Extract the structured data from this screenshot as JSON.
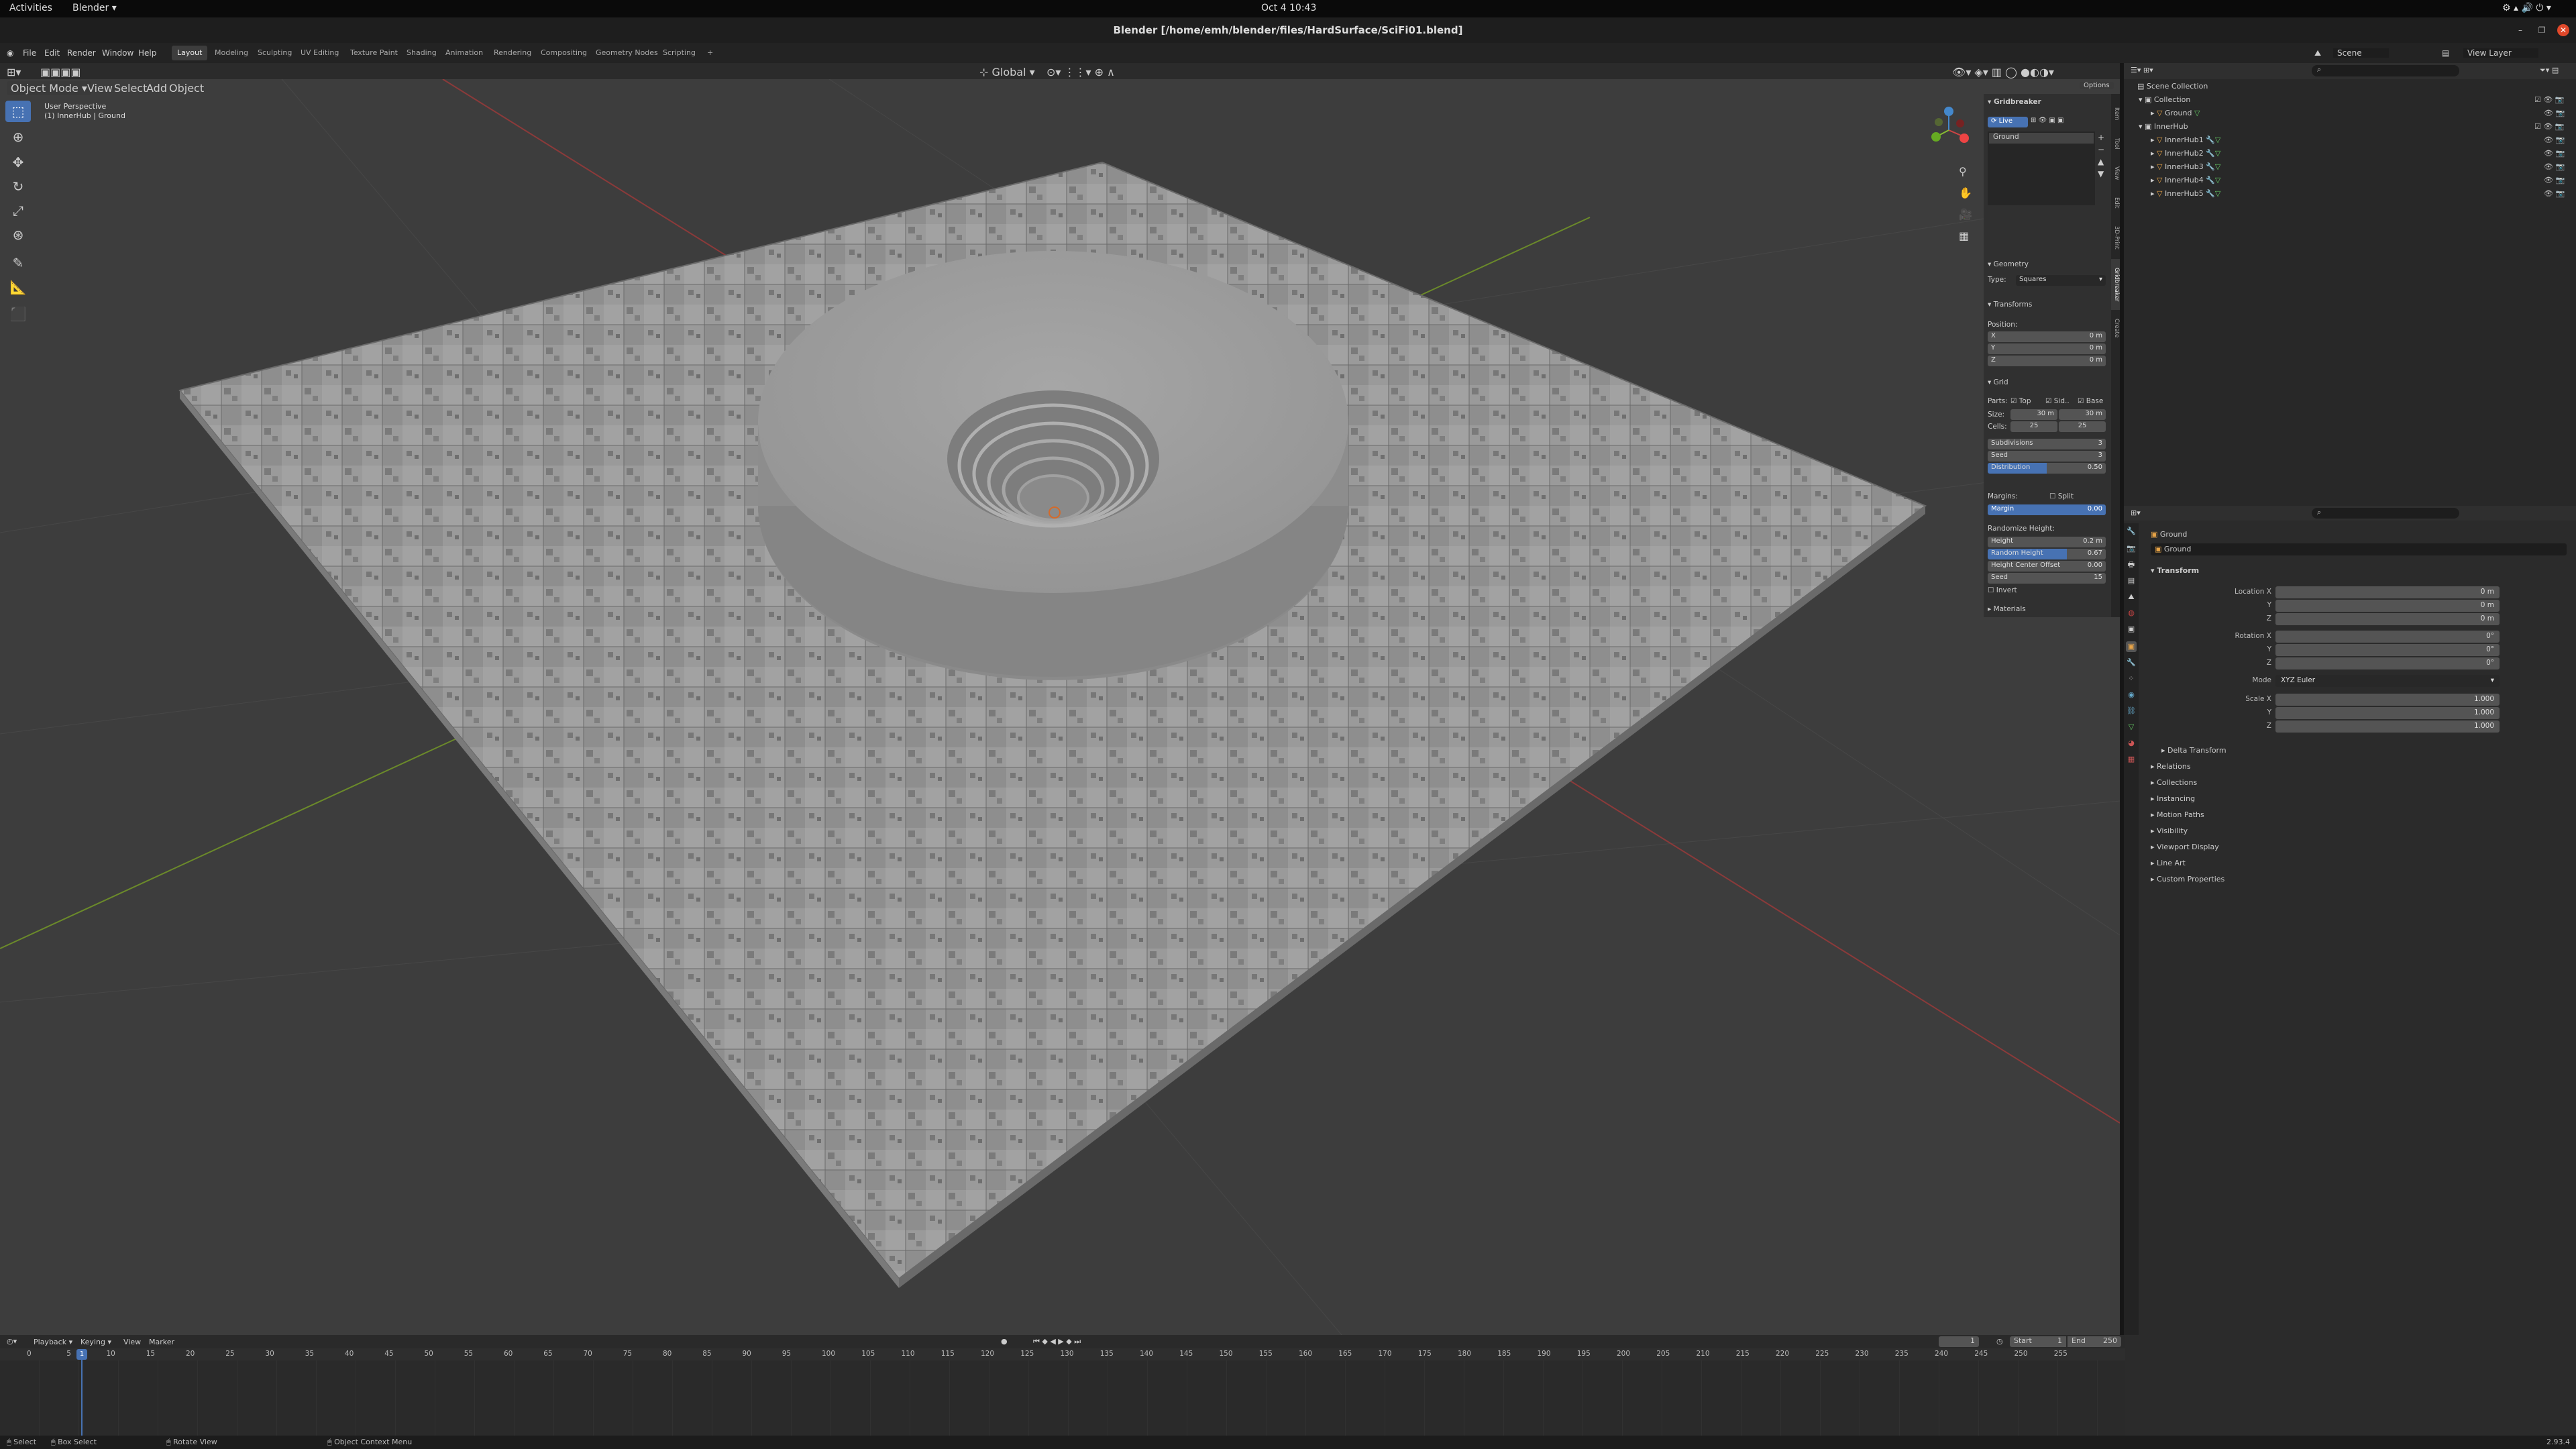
{
  "gnome": {
    "activities": "Activities",
    "app": "Blender",
    "clock": "Oct 4  10:43"
  },
  "window": {
    "title": "Blender [/home/emh/blender/files/HardSurface/SciFi01.blend]"
  },
  "menu": {
    "items": [
      "File",
      "Edit",
      "Render",
      "Window",
      "Help"
    ]
  },
  "workspaces": [
    "Layout",
    "Modeling",
    "Sculpting",
    "UV Editing",
    "Texture Paint",
    "Shading",
    "Animation",
    "Rendering",
    "Compositing",
    "Geometry Nodes",
    "Scripting"
  ],
  "workspace_add": "+",
  "scene": {
    "name": "Scene",
    "view_layer": "View Layer"
  },
  "viewport": {
    "mode": "Object Mode",
    "menus": [
      "View",
      "Select",
      "Add",
      "Object"
    ],
    "transform_orientation": "Global",
    "options": "Options",
    "view_name": "User Perspective",
    "view_object": "(1) InnerHub | Ground"
  },
  "npanel": {
    "addon": "Gridbreaker",
    "live": "Live",
    "target": "Ground",
    "geometry": "Geometry",
    "type_label": "Type:",
    "type_value": "Squares",
    "transforms": "Transforms",
    "position": "Position:",
    "pos": [
      {
        "axis": "X",
        "value": "0 m"
      },
      {
        "axis": "Y",
        "value": "0 m"
      },
      {
        "axis": "Z",
        "value": "0 m"
      }
    ],
    "grid": "Grid",
    "parts": "Parts:",
    "part_items": [
      "Top",
      "Sid..",
      "Base"
    ],
    "size_label": "Size:",
    "size_x": "30 m",
    "size_y": "30 m",
    "cells_label": "Cells:",
    "cells_x": "25",
    "cells_y": "25",
    "subdivisions": {
      "label": "Subdivisions",
      "value": "3"
    },
    "seed1": {
      "label": "Seed",
      "value": "3"
    },
    "distribution": {
      "label": "Distribution",
      "value": "0.50"
    },
    "margins": "Margins:",
    "split": "Split",
    "margin": {
      "label": "Margin",
      "value": "0.00"
    },
    "randomize_height": "Randomize Height:",
    "height": {
      "label": "Height",
      "value": "0.2 m"
    },
    "random_height": {
      "label": "Random Height",
      "value": "0.67"
    },
    "height_center_offset": {
      "label": "Height Center Offset",
      "value": "0.00"
    },
    "seed2": {
      "label": "Seed",
      "value": "15"
    },
    "invert": "Invert",
    "materials": "Materials",
    "tabs": [
      "Item",
      "Tool",
      "View",
      "Edit",
      "3D-Print",
      "Gridbreaker",
      "Create"
    ]
  },
  "outliner": {
    "root": "Scene Collection",
    "items": [
      {
        "name": "Collection",
        "depth": 1
      },
      {
        "name": "Ground",
        "depth": 2
      },
      {
        "name": "InnerHub",
        "depth": 1
      },
      {
        "name": "InnerHub1",
        "depth": 2
      },
      {
        "name": "InnerHub2",
        "depth": 2
      },
      {
        "name": "InnerHub3",
        "depth": 2
      },
      {
        "name": "InnerHub4",
        "depth": 2
      },
      {
        "name": "InnerHub5",
        "depth": 2
      }
    ]
  },
  "properties": {
    "object": "Ground",
    "object_field": "Ground",
    "transform": "Transform",
    "location": {
      "label": "Location X",
      "x": "0 m",
      "y": "0 m",
      "z": "0 m"
    },
    "rotation": {
      "label": "Rotation X",
      "x": "0°",
      "y": "0°",
      "z": "0°"
    },
    "mode": {
      "label": "Mode",
      "value": "XYZ Euler"
    },
    "scale": {
      "label": "Scale X",
      "x": "1.000",
      "y": "1.000",
      "z": "1.000"
    },
    "axis_y": "Y",
    "axis_z": "Z",
    "delta_transform": "Delta Transform",
    "sections": [
      "Relations",
      "Collections",
      "Instancing",
      "Motion Paths",
      "Visibility",
      "Viewport Display",
      "Line Art",
      "Custom Properties"
    ]
  },
  "timeline": {
    "menus": [
      "Playback",
      "Keying",
      "View",
      "Marker"
    ],
    "current_frame": "1",
    "start_label": "Start",
    "start": "1",
    "end_label": "End",
    "end": "250",
    "ticks": [
      0,
      5,
      10,
      15,
      20,
      25,
      30,
      35,
      40,
      45,
      50,
      55,
      60,
      65,
      70,
      75,
      80,
      85,
      90,
      95,
      100,
      105,
      110,
      115,
      120,
      125,
      130,
      135,
      140,
      145,
      150,
      155,
      160,
      165,
      170,
      175,
      180,
      185,
      190,
      195,
      200,
      205,
      210,
      215,
      220,
      225,
      230,
      235,
      240,
      245,
      250,
      255
    ]
  },
  "status": {
    "select": "Select",
    "box_select": "Box Select",
    "rotate_view": "Rotate View",
    "context_menu": "Object Context Menu",
    "version": "2.93.4"
  }
}
